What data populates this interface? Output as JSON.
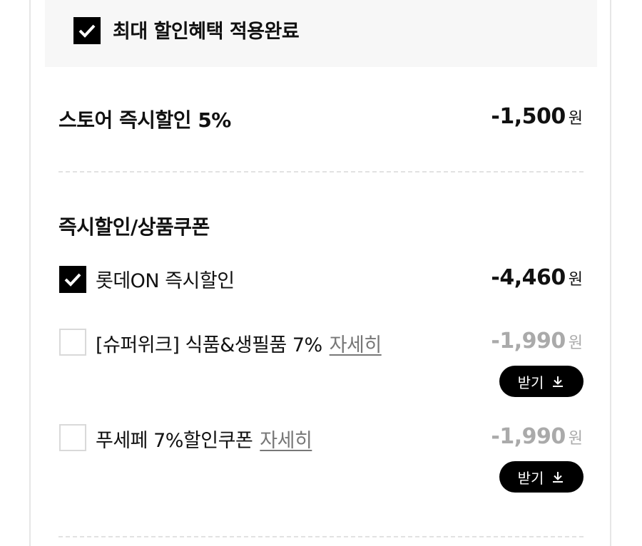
{
  "banner": {
    "label": "최대 할인혜택 적용완료",
    "checked": true
  },
  "store_discount": {
    "title": "스토어 즉시할인 5%",
    "amount": "-1,500",
    "unit": "원"
  },
  "coupon_section": {
    "title": "즉시할인/상품쿠폰",
    "items": [
      {
        "label": "롯데ON 즉시할인",
        "amount": "-4,460",
        "unit": "원",
        "checked": true
      },
      {
        "label": "[슈퍼위크] 식품&생필품 7%",
        "detail_link": "자세히",
        "amount": "-1,990",
        "unit": "원",
        "checked": false,
        "button_label": "받기"
      },
      {
        "label": "푸세페 7%할인쿠폰",
        "detail_link": "자세히",
        "amount": "-1,990",
        "unit": "원",
        "checked": false,
        "button_label": "받기"
      }
    ]
  },
  "icons": [
    "check-icon",
    "download-icon"
  ],
  "colors": {
    "accent": "#000000",
    "muted_amount": "#aaaaaa",
    "banner_bg": "#f7f7f7"
  }
}
